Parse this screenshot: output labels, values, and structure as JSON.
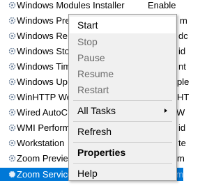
{
  "services": [
    {
      "name": "Windows Modules Installer",
      "status": "Enable"
    },
    {
      "name": "Windows Pre",
      "status": "m"
    },
    {
      "name": "Windows Re",
      "status": "dc"
    },
    {
      "name": "Windows Sto",
      "status": "id"
    },
    {
      "name": "Windows Tim",
      "status": "nt"
    },
    {
      "name": "Windows Up",
      "status": "ple"
    },
    {
      "name": "WinHTTP We",
      "status": "HT"
    },
    {
      "name": "Wired AutoC",
      "status": "W"
    },
    {
      "name": "WMI Perform",
      "status": "id"
    },
    {
      "name": "Workstation",
      "status": "te"
    },
    {
      "name": "Zoom Previe",
      "status": "m"
    },
    {
      "name": "Zoom Service",
      "status": "Zoom"
    }
  ],
  "menu": {
    "start": "Start",
    "stop": "Stop",
    "pause": "Pause",
    "resume": "Resume",
    "restart": "Restart",
    "all_tasks": "All Tasks",
    "refresh": "Refresh",
    "properties": "Properties",
    "help": "Help"
  },
  "colors": {
    "selection": "#0078d7",
    "menu_bg": "#f0f0f0"
  },
  "icon": "gear-icon"
}
